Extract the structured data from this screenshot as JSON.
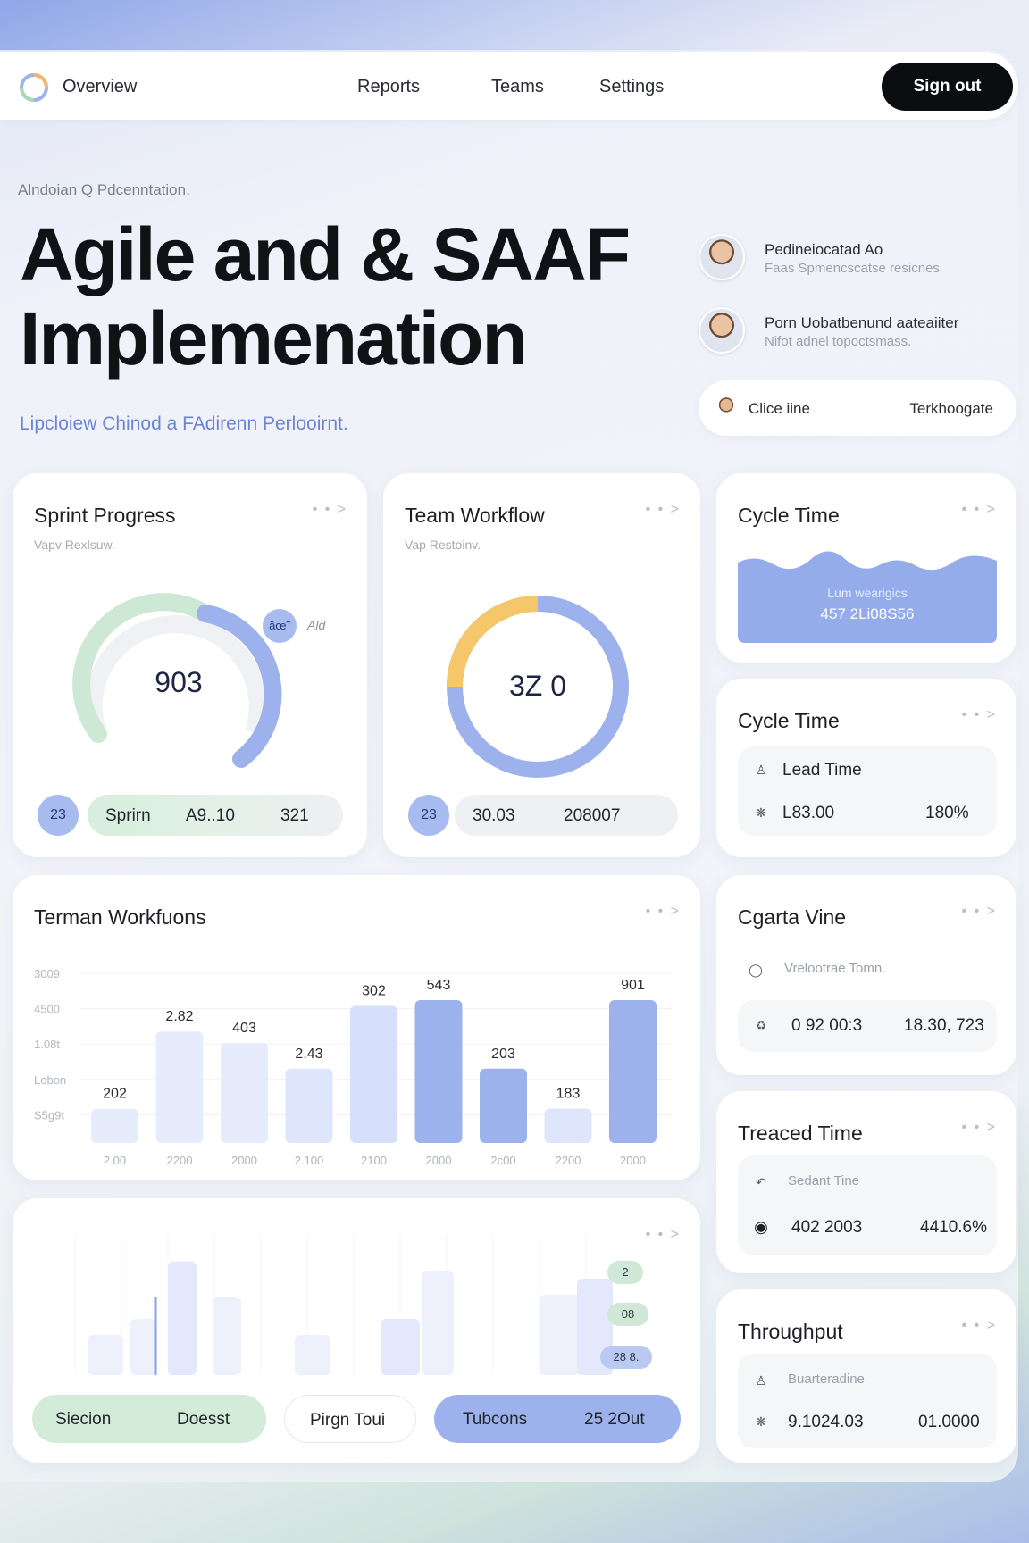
{
  "nav": {
    "overview_label": "Overview",
    "links": [
      "Reports",
      "Teams",
      "Settings"
    ],
    "signout_label": "Sign out"
  },
  "hero": {
    "eyebrow": "Alndoian  Q Pdcenntation.",
    "title_line1": "Agile and & SAAF",
    "title_line2": "Implemenation",
    "subtitle": "Lipcloiew Chinod a FAdirenn Perlooirnt."
  },
  "people": [
    {
      "name": "Pedineiocatad  Ao",
      "role": "Faas Spmencscatse resicnes"
    },
    {
      "name": "Porn Uobatbenund aateaiiter",
      "role": "Nifot adnel topoctsmass."
    }
  ],
  "pill_control": {
    "left": "Clice iine",
    "right": "Terkhoogate"
  },
  "colors": {
    "accent_blue": "#94acea",
    "accent_green": "#cce8d3",
    "accent_yellow": "#f6c66b",
    "dark": "#0c0d10"
  },
  "sprint_progress": {
    "title": "Sprint Progress",
    "subtitle": "Vapv  Rexlsuw.",
    "value": "903",
    "badge_icon_label": "âœ˜",
    "badge_text": "Ald",
    "dot": "23",
    "pill": [
      "Sprirn",
      "A9..10",
      "321"
    ],
    "green_fraction": 0.55,
    "blue_fraction": 0.3
  },
  "team_workflow": {
    "title": "Team Workflow",
    "subtitle": "Vap  Restoinv.",
    "value": "3Z 0",
    "dot": "23",
    "pill": [
      "30.03",
      "208007"
    ],
    "yellow_fraction": 0.22
  },
  "cycle_time_1": {
    "title": "Cycle Time",
    "line1": "Lum wearigics",
    "line2": "457 2Li08S56"
  },
  "cycle_time_2": {
    "title": "Cycle Time",
    "row1": "Lead Time",
    "row2_value": "L83.00",
    "row2_pct": "180%"
  },
  "bar_chart": {
    "title": "Terman Workfuons",
    "y_ticks": [
      "3009",
      "4500",
      "1.08t",
      "Lobon",
      "S5g9t"
    ],
    "x_ticks": [
      "2.00",
      "2200",
      "2000",
      "2.100",
      "2100",
      "2000",
      "2c00",
      "2200",
      "2000"
    ],
    "bar_labels": [
      "202",
      "2.82",
      "403",
      "2.43",
      "302",
      "543",
      "203",
      "183",
      "901"
    ]
  },
  "chart_data": {
    "type": "bar",
    "title": "Terman Workfuons",
    "categories": [
      "2.00",
      "2200",
      "2000",
      "2.100",
      "2100",
      "2000",
      "2c00",
      "2200",
      "2000"
    ],
    "values": [
      202,
      282,
      403,
      243,
      302,
      543,
      203,
      183,
      901
    ],
    "relative_heights": [
      0.24,
      0.78,
      0.7,
      0.52,
      0.96,
      1.0,
      0.52,
      0.24,
      1.0
    ],
    "colors": [
      "#e6ecfb",
      "#e6ecfb",
      "#e6ecfb",
      "#dfe6fb",
      "#d7e0fa",
      "#9cb2ec",
      "#9cb2ec",
      "#dfe6fb",
      "#9cb2ec"
    ]
  },
  "lower_chart": {
    "chips": [
      "2",
      "08",
      "28 8."
    ],
    "bars": [
      0.3,
      0.42,
      0.85,
      0.58,
      0.3,
      0.42,
      0.78,
      0.6,
      0.72
    ],
    "pills": [
      {
        "a": "Siecion",
        "b": "Doesst"
      },
      {
        "a": "Pirgn Toui"
      },
      {
        "a": "Tubcons",
        "b": "25 2Out"
      }
    ]
  },
  "cgarta": {
    "title": "Cgarta Vine",
    "row1": "Vrelootrae Tomn.",
    "row2": "0 92  00:3",
    "row2_right": "18.30, 723"
  },
  "treaced": {
    "title": "Treaced Time",
    "row1": "Sedant Tine",
    "row2": "402 2003",
    "row2_right": "4410.6%"
  },
  "throughput": {
    "title": "Throughput",
    "row1": "Buarteradine",
    "row2": "9.1024.03",
    "row2_right": "01.0000"
  }
}
